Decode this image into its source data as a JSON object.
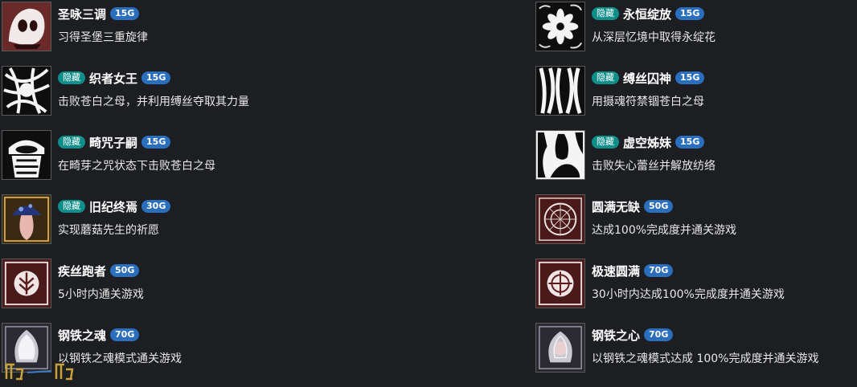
{
  "left": [
    {
      "name": "圣咏三调",
      "points": "15G",
      "hidden": false,
      "desc": "习得圣堡三重旋律",
      "icon": "mask-shell-icon"
    },
    {
      "name": "织者女王",
      "points": "15G",
      "hidden": true,
      "desc": "击败苍白之母，并利用缚丝夺取其力量",
      "icon": "weaver-queen-icon"
    },
    {
      "name": "畸咒子嗣",
      "points": "15G",
      "hidden": true,
      "desc": "在畸芽之咒状态下击败苍白之母",
      "icon": "cursed-child-icon"
    },
    {
      "name": "旧纪终焉",
      "points": "30G",
      "hidden": true,
      "desc": "实现蘑菇先生的祈愿",
      "icon": "mushroom-icon"
    },
    {
      "name": "疾丝跑者",
      "points": "50G",
      "hidden": false,
      "desc": "5小时内通关游戏",
      "icon": "leaf-emblem-icon"
    },
    {
      "name": "钢铁之魂",
      "points": "70G",
      "hidden": false,
      "desc": "以钢铁之魂模式通关游戏",
      "icon": "steel-soul-icon"
    }
  ],
  "right": [
    {
      "name": "永恒绽放",
      "points": "15G",
      "hidden": true,
      "desc": "从深层忆境中取得永绽花",
      "icon": "bloom-flower-icon"
    },
    {
      "name": "缚丝囚神",
      "points": "15G",
      "hidden": true,
      "desc": "用摄魂符禁锢苍白之母",
      "icon": "bound-silk-icon"
    },
    {
      "name": "虚空姊妹",
      "points": "15G",
      "hidden": true,
      "desc": "击败失心蕾丝并解放纺络",
      "icon": "void-sister-icon"
    },
    {
      "name": "圆满无缺",
      "points": "50G",
      "hidden": false,
      "desc": "达成100%完成度并通关游戏",
      "icon": "completion-emblem-icon"
    },
    {
      "name": "极速圆满",
      "points": "70G",
      "hidden": false,
      "desc": "30小时内达成100%完成度并通关游戏",
      "icon": "speed-completion-icon"
    },
    {
      "name": "钢铁之心",
      "points": "70G",
      "hidden": false,
      "desc": "以钢铁之魂模式达成 100%完成度并通关游戏",
      "icon": "steel-heart-icon"
    }
  ],
  "hidden_label": "隐藏",
  "colors": {
    "background": "#1c1e22",
    "hidden_badge": "#0f8f8a",
    "points_badge": "#2a6ebc"
  }
}
